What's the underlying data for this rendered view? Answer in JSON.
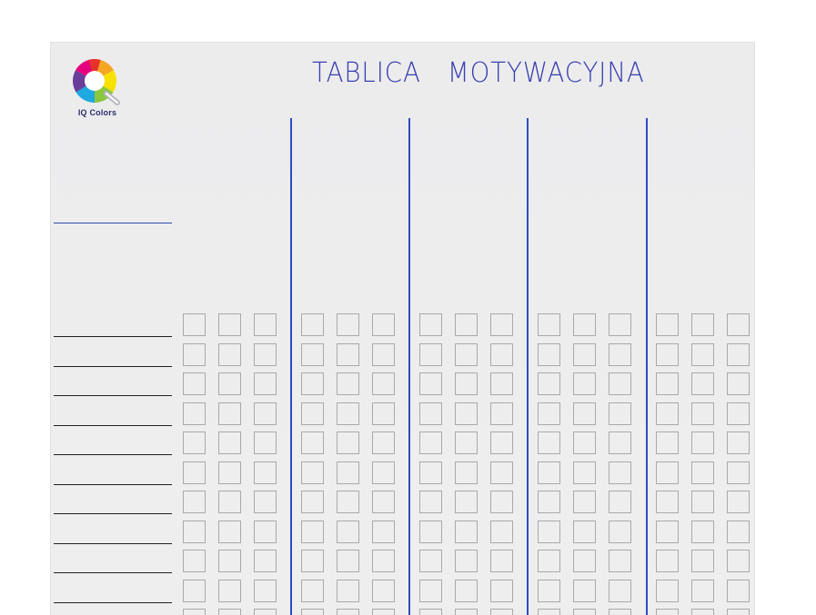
{
  "board": {
    "title": "TABLICA   MOTYWACYJNA",
    "logo": {
      "text": "IQ Colors",
      "icon": "iq-colors-logo-icon",
      "colors": [
        "#e8312b",
        "#f5a623",
        "#f7e100",
        "#8cc63f",
        "#1fa9e1",
        "#6a3d9a",
        "#e4007e"
      ]
    },
    "colors": {
      "divider": "#2d4cc0",
      "title": "#3a3fb0",
      "grid_border": "#a9a9ab",
      "board_bg": "#ededee"
    },
    "columns": 5,
    "checkboxes_per_column": 3,
    "rows_visible": 10
  }
}
